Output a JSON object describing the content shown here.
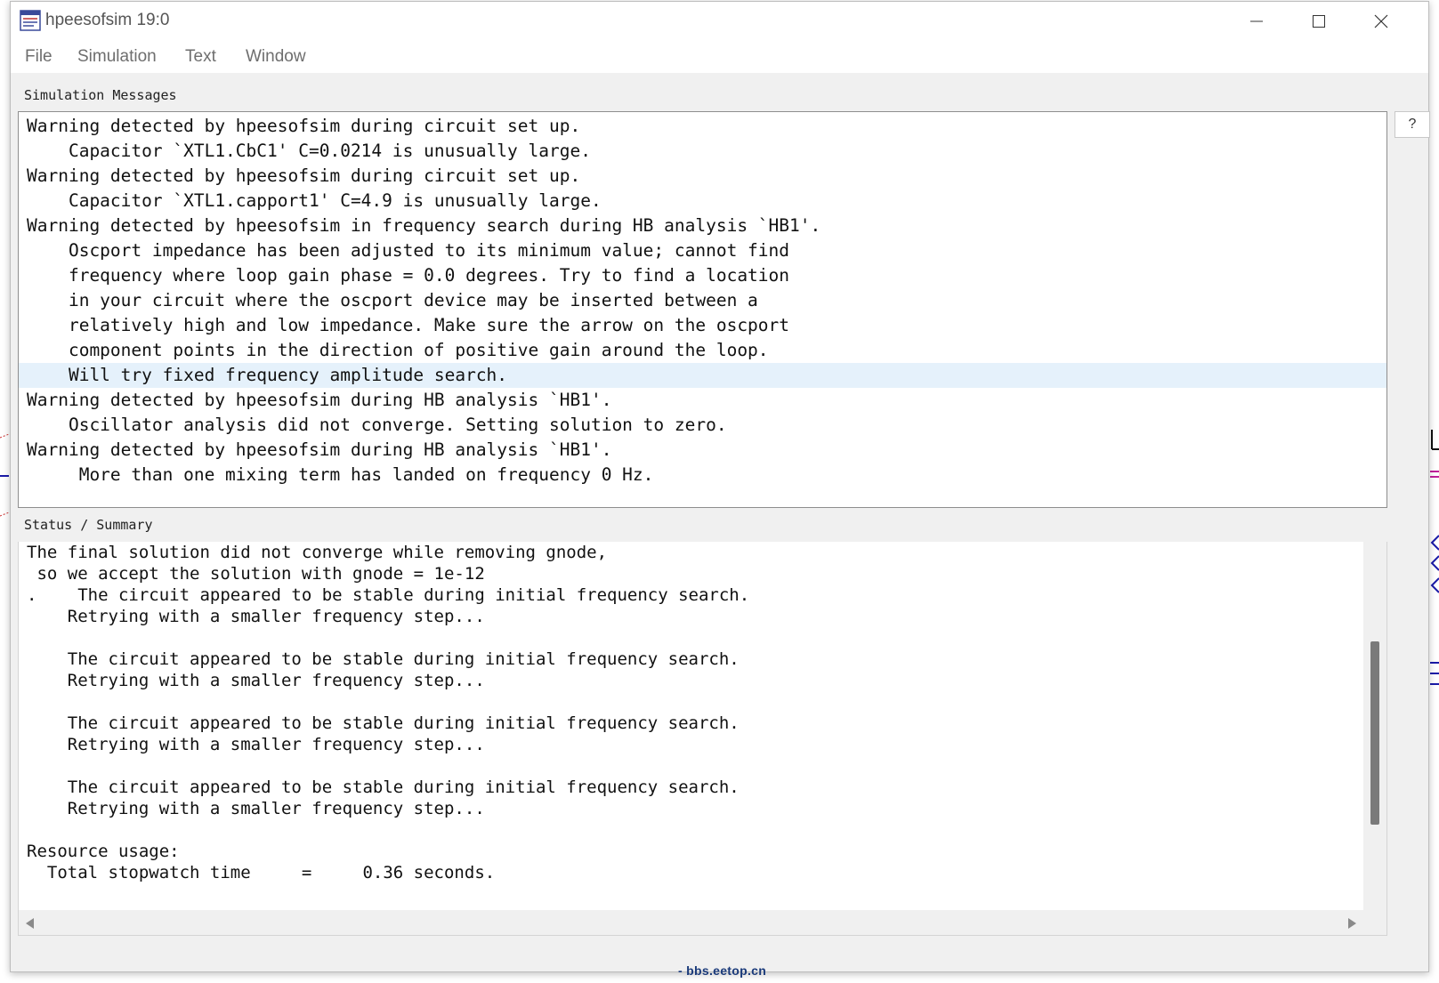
{
  "window": {
    "title": "hpeesofsim 19:0"
  },
  "menu": {
    "items": [
      "File",
      "Simulation",
      "Text",
      "Window"
    ]
  },
  "messages": {
    "label": "Simulation Messages",
    "help_label": "?",
    "lines": [
      "Warning detected by hpeesofsim during circuit set up.",
      "    Capacitor `XTL1.CbC1' C=0.0214 is unusually large.",
      "Warning detected by hpeesofsim during circuit set up.",
      "    Capacitor `XTL1.capport1' C=4.9 is unusually large.",
      "Warning detected by hpeesofsim in frequency search during HB analysis `HB1'.",
      "    Oscport impedance has been adjusted to its minimum value; cannot find",
      "    frequency where loop gain phase = 0.0 degrees. Try to find a location",
      "    in your circuit where the oscport device may be inserted between a",
      "    relatively high and low impedance. Make sure the arrow on the oscport",
      "    component points in the direction of positive gain around the loop.",
      "    Will try fixed frequency amplitude search.",
      "Warning detected by hpeesofsim during HB analysis `HB1'.",
      "    Oscillator analysis did not converge. Setting solution to zero.",
      "Warning detected by hpeesofsim during HB analysis `HB1'.",
      "     More than one mixing term has landed on frequency 0 Hz."
    ]
  },
  "status": {
    "label": "Status / Summary",
    "lines": [
      "The final solution did not converge while removing gnode,",
      " so we accept the solution with gnode = 1e-12",
      ".    The circuit appeared to be stable during initial frequency search.",
      "    Retrying with a smaller frequency step...",
      "",
      "    The circuit appeared to be stable during initial frequency search.",
      "    Retrying with a smaller frequency step...",
      "",
      "    The circuit appeared to be stable during initial frequency search.",
      "    Retrying with a smaller frequency step...",
      "",
      "    The circuit appeared to be stable during initial frequency search.",
      "    Retrying with a smaller frequency step...",
      "",
      "Resource usage:",
      "  Total stopwatch time     =     0.36 seconds."
    ]
  },
  "watermark": "- bbs.eetop.cn",
  "colors": {
    "selection": "#e5f1fb",
    "window_bg": "#f0f0f0",
    "schematic_blue": "#1a1aa8"
  }
}
